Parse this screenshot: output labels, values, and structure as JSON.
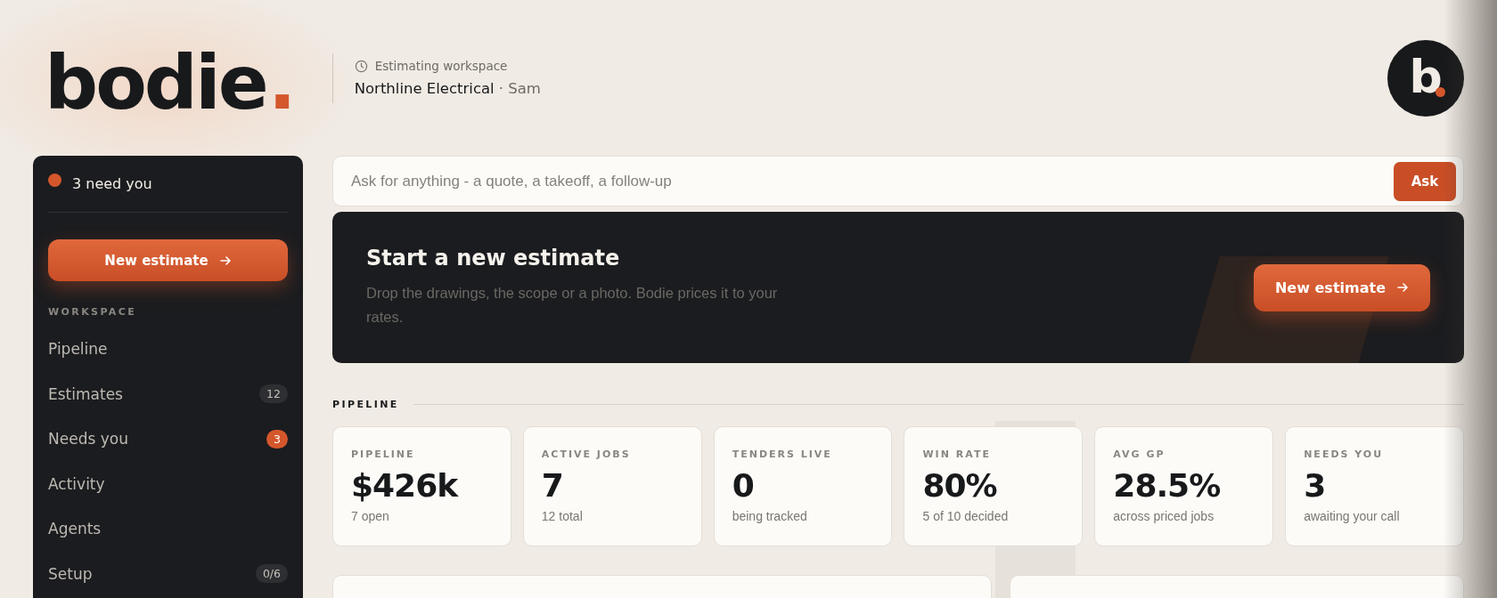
{
  "brand": {
    "name": "bodie",
    "dot": "."
  },
  "workspace": {
    "label": "Estimating workspace",
    "company": "Northline Electrical",
    "user": "· Sam"
  },
  "avatar": {
    "letter": "b"
  },
  "sidebar": {
    "alert": "3 need you",
    "new_button": "New estimate",
    "section": "WORKSPACE",
    "items": [
      {
        "label": "Pipeline"
      },
      {
        "label": "Estimates",
        "badge": "12",
        "kind": "count"
      },
      {
        "label": "Needs you",
        "badge": "3",
        "kind": "alert"
      },
      {
        "label": "Activity"
      },
      {
        "label": "Agents"
      },
      {
        "label": "Setup",
        "badge": "0/6",
        "kind": "count"
      }
    ]
  },
  "search": {
    "placeholder": "Ask for anything - a quote, a takeoff, a follow-up",
    "button": "Ask"
  },
  "hero": {
    "title": "Start a new estimate",
    "text": "Drop the drawings, the scope or a photo. Bodie prices it to your rates.",
    "button": "New estimate"
  },
  "pipeline": {
    "heading": "PIPELINE",
    "stats": [
      {
        "label": "PIPELINE",
        "value": "$426k",
        "note": "7 open"
      },
      {
        "label": "ACTIVE JOBS",
        "value": "7",
        "note": "12 total"
      },
      {
        "label": "TENDERS LIVE",
        "value": "0",
        "note": "being tracked"
      },
      {
        "label": "WIN RATE",
        "value": "80%",
        "note": "5 of 10 decided"
      },
      {
        "label": "AVG GP",
        "value": "28.5%",
        "note": "across priced jobs"
      },
      {
        "label": "NEEDS YOU",
        "value": "3",
        "note": "awaiting your call"
      }
    ]
  }
}
